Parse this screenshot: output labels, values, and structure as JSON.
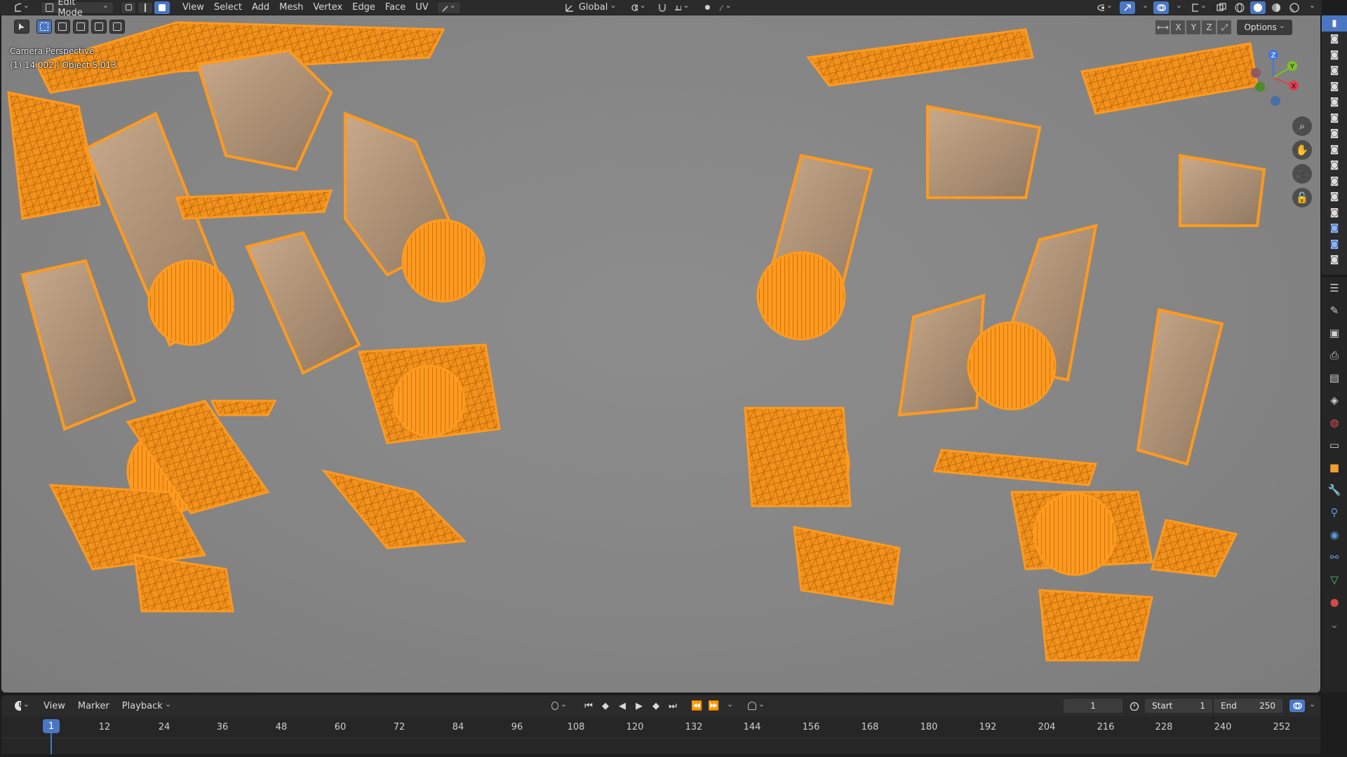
{
  "header": {
    "mode": "Edit Mode",
    "menus": [
      "View",
      "Select",
      "Add",
      "Mesh",
      "Vertex",
      "Edge",
      "Face",
      "UV"
    ],
    "transform_orientation": "Global"
  },
  "viewport": {
    "view_name": "Camera Perspective",
    "object_info": "(1) 14.002 | Object 5.013",
    "axis_labels": [
      "X",
      "Y",
      "Z"
    ],
    "options_label": "Options",
    "gizmo_labels": {
      "z": "Z",
      "y": "Y",
      "x": "X"
    },
    "mesh_color": "#ff9a1f"
  },
  "timeline": {
    "menus": [
      "View",
      "Marker",
      "Playback"
    ],
    "current_frame": "1",
    "start_label": "Start",
    "start_value": "1",
    "end_label": "End",
    "end_value": "250",
    "ruler": [
      "1",
      "12",
      "24",
      "36",
      "48",
      "60",
      "72",
      "84",
      "96",
      "108",
      "120",
      "132",
      "144",
      "156",
      "168",
      "180",
      "192",
      "204",
      "216",
      "228",
      "240",
      "252"
    ]
  },
  "colors": {
    "accent": "#4a77c3",
    "header_bg": "#2b2b2b",
    "viewport_bg": "#858585"
  }
}
